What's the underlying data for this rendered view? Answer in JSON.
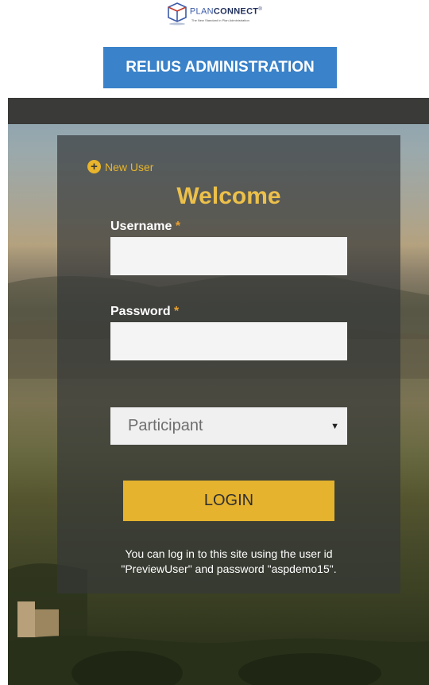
{
  "logo": {
    "plan": "PLAN",
    "connect": "CONNECT",
    "tm": "®",
    "tagline": "The New Standard in Plan Administration"
  },
  "header": {
    "admin_button_label": "RELIUS ADMINISTRATION"
  },
  "login": {
    "new_user_label": "New User",
    "welcome_title": "Welcome",
    "username_label": "Username",
    "password_label": "Password",
    "required_marker": "*",
    "username_value": "",
    "password_value": "",
    "role_selected": "Participant",
    "login_button_label": "LOGIN",
    "hint_line1": "You can log in to this site using the user id",
    "hint_line2": "\"PreviewUser\" and password \"aspdemo15\"."
  },
  "colors": {
    "admin_button": "#3a82c9",
    "accent_gold": "#e5b32e",
    "welcome_text": "#ecc04a",
    "panel": "#343738"
  }
}
